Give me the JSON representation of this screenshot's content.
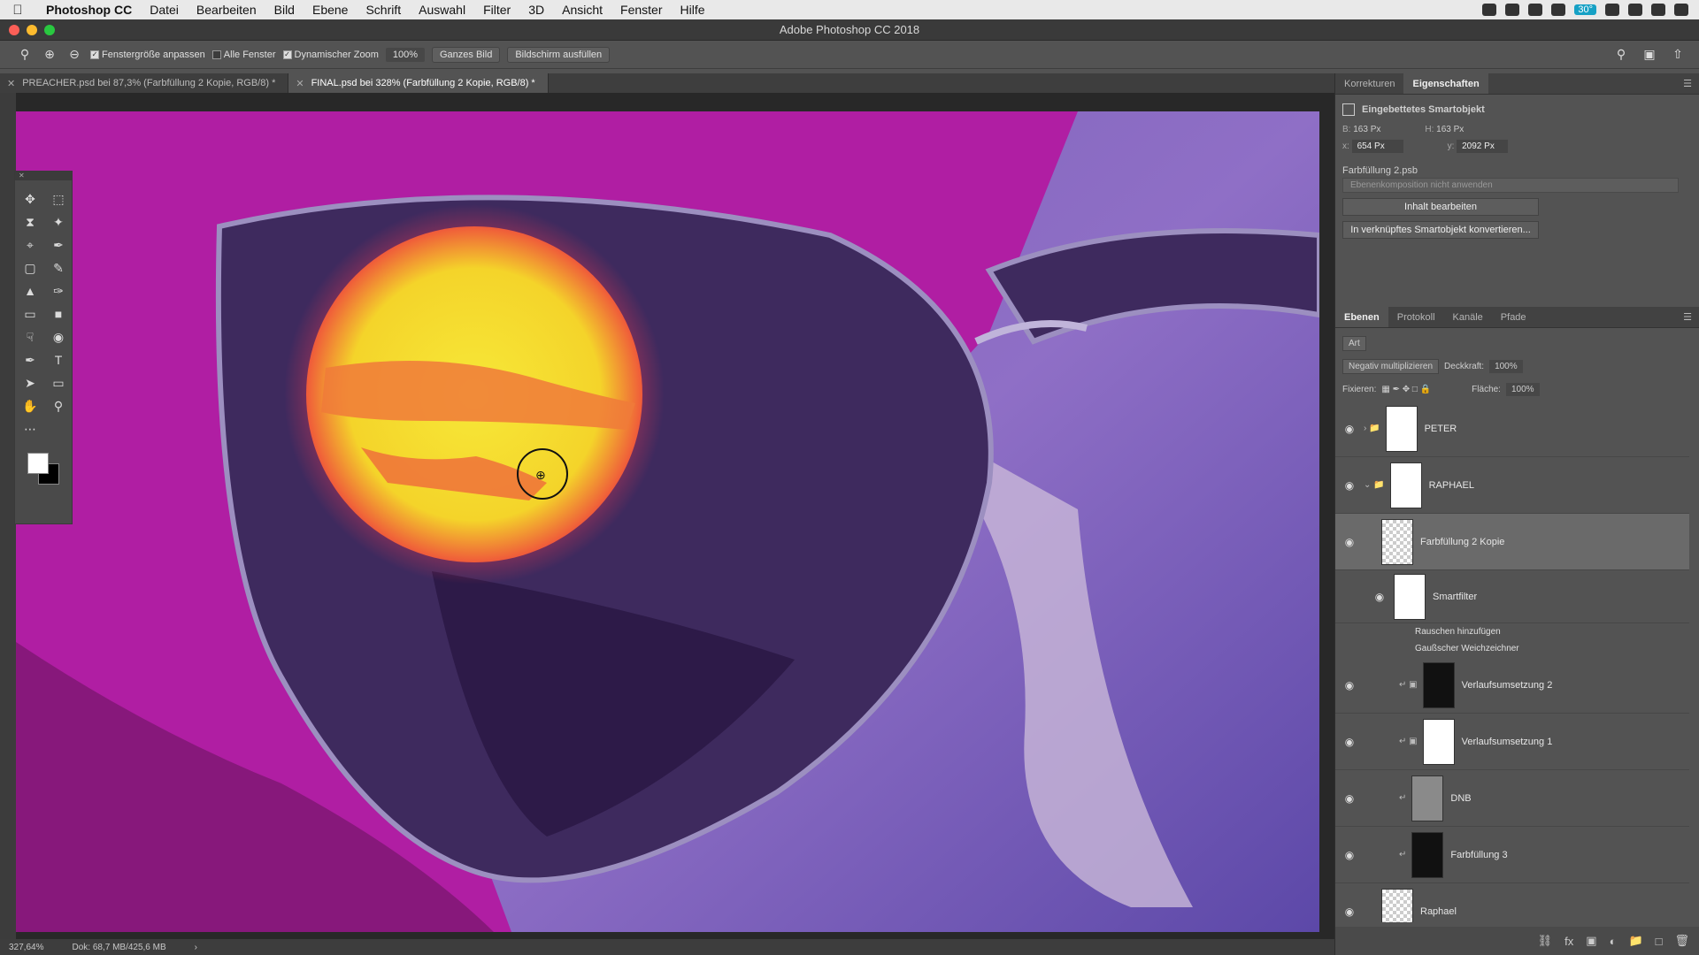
{
  "menubar": {
    "app": "Photoshop CC",
    "items": [
      "Datei",
      "Bearbeiten",
      "Bild",
      "Ebene",
      "Schrift",
      "Auswahl",
      "Filter",
      "3D",
      "Ansicht",
      "Fenster",
      "Hilfe"
    ],
    "badge": "30°"
  },
  "window": {
    "title": "Adobe Photoshop CC 2018"
  },
  "options": {
    "fit_window": "Fenstergröße anpassen",
    "all_windows": "Alle Fenster",
    "dynamic_zoom": "Dynamischer Zoom",
    "zoom_value": "100%",
    "whole_image": "Ganzes Bild",
    "fill_screen": "Bildschirm ausfüllen"
  },
  "tabs": [
    {
      "label": "PREACHER.psd bei 87,3% (Farbfüllung 2 Kopie, RGB/8) *"
    },
    {
      "label": "FINAL.psd bei 328% (Farbfüllung 2 Kopie, RGB/8) *"
    }
  ],
  "properties": {
    "tabs": [
      "Korrekturen",
      "Eigenschaften"
    ],
    "header": "Eingebettetes Smartobjekt",
    "w_label": "B:",
    "w_value": "163 Px",
    "h_label": "H:",
    "h_value": "163 Px",
    "x_label": "x:",
    "x_value": "654 Px",
    "y_label": "y:",
    "y_value": "2092 Px",
    "file": "Farbfüllung 2.psb",
    "comp_select": "Ebenenkomposition nicht anwenden",
    "edit_button": "Inhalt bearbeiten",
    "convert_button": "In verknüpftes Smartobjekt konvertieren..."
  },
  "layers_panel": {
    "tabs": [
      "Ebenen",
      "Protokoll",
      "Kanäle",
      "Pfade"
    ],
    "filter": "Art",
    "blend_mode": "Negativ multiplizieren",
    "opacity_label": "Deckkraft:",
    "opacity": "100%",
    "lock_label": "Fixieren:",
    "fill_label": "Fläche:",
    "fill": "100%",
    "layers": [
      {
        "name": "PETER"
      },
      {
        "name": "RAPHAEL"
      },
      {
        "name": "Farbfüllung 2 Kopie"
      },
      {
        "name": "Smartfilter"
      },
      {
        "name": "Rauschen hinzufügen"
      },
      {
        "name": "Gaußscher Weichzeichner"
      },
      {
        "name": "Verlaufsumsetzung 2"
      },
      {
        "name": "Verlaufsumsetzung 1"
      },
      {
        "name": "DNB"
      },
      {
        "name": "Farbfüllung 3"
      },
      {
        "name": "Raphael"
      }
    ]
  },
  "status": {
    "zoom": "327,64%",
    "doc": "Dok: 68,7 MB/425,6 MB"
  }
}
